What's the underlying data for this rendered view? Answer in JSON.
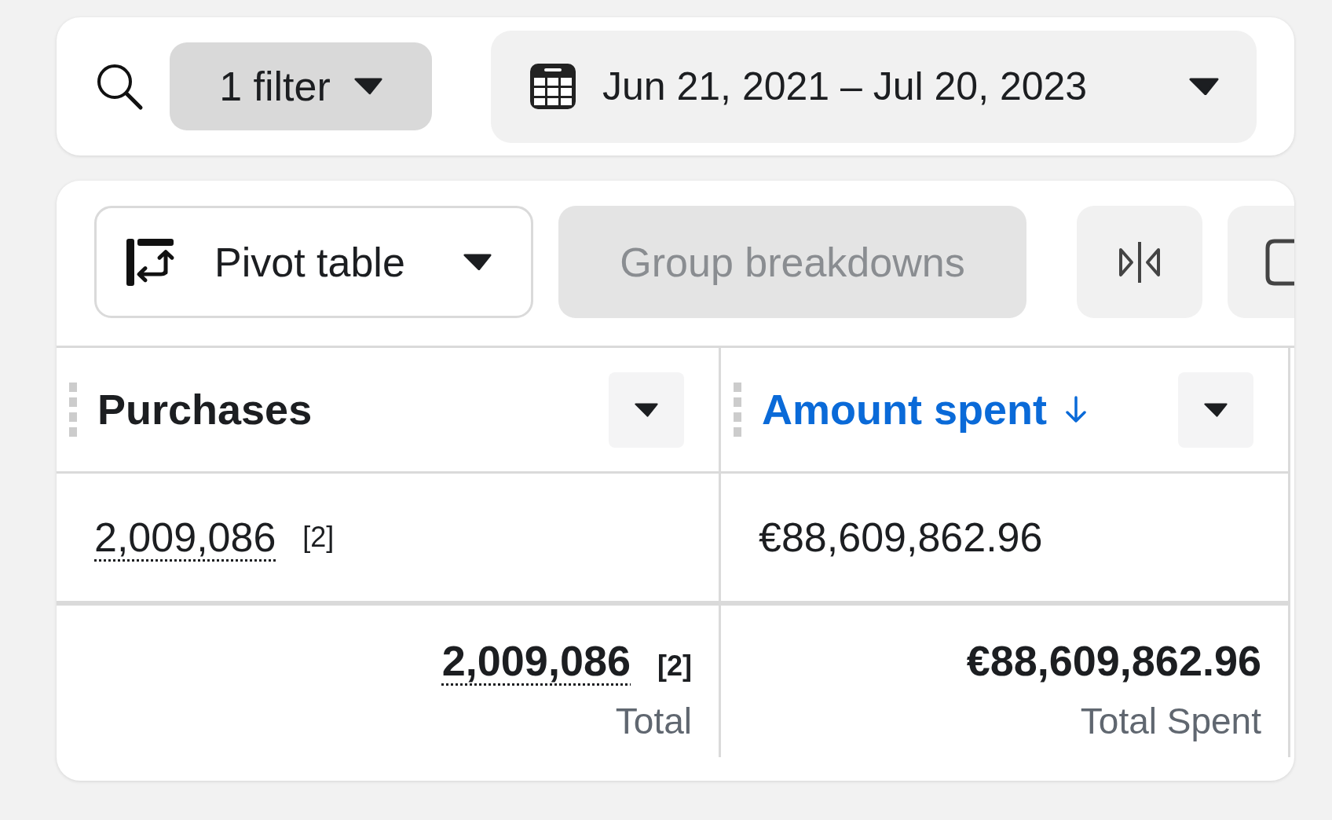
{
  "search": {
    "kind": "icon"
  },
  "filter_button": {
    "label": "1 filter"
  },
  "date_range": {
    "label": "Jun 21, 2021 – Jul 20, 2023"
  },
  "toolbar": {
    "view_select": {
      "label": "Pivot table"
    },
    "group_button": {
      "label": "Group breakdowns",
      "disabled": true
    }
  },
  "table": {
    "columns": [
      {
        "label": "Purchases",
        "sorted": false
      },
      {
        "label": "Amount spent",
        "sorted": true
      }
    ],
    "rows": [
      [
        {
          "value": "2,009,086",
          "note": "[2]"
        },
        {
          "value": "€88,609,862.96"
        }
      ]
    ],
    "totals": [
      {
        "value": "2,009,086",
        "note": "[2]",
        "caption": "Total"
      },
      {
        "value": "€88,609,862.96",
        "caption": "Total Spent"
      }
    ]
  }
}
